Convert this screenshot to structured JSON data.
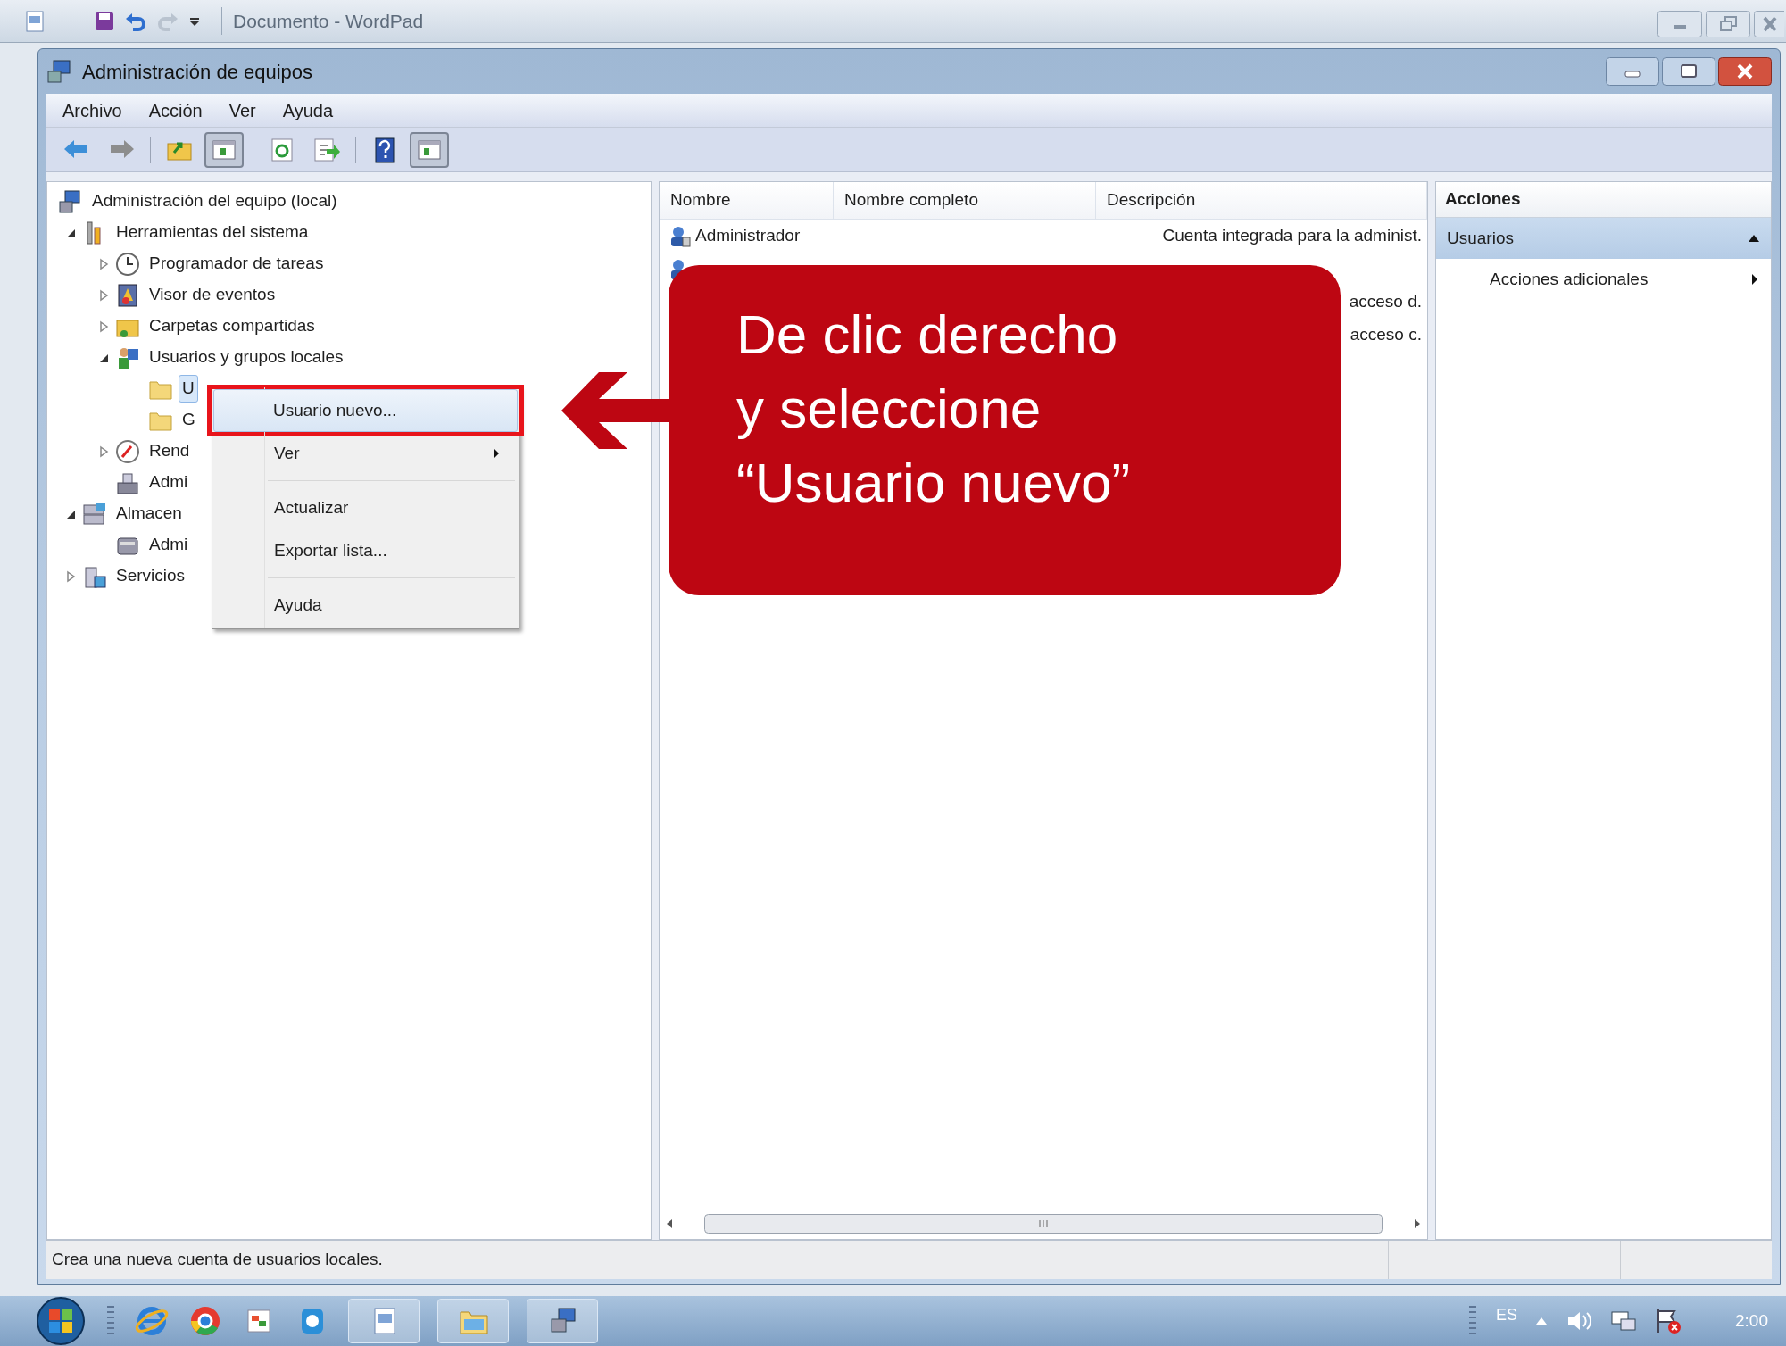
{
  "background_window": {
    "title": "Documento - WordPad"
  },
  "window": {
    "title": "Administración de equipos"
  },
  "menu": [
    "Archivo",
    "Acción",
    "Ver",
    "Ayuda"
  ],
  "toolbar": [
    {
      "pressed": false
    },
    {
      "pressed": false
    },
    {
      "pressed": false
    },
    {
      "pressed": true
    },
    {
      "pressed": false
    },
    {
      "pressed": false
    },
    {
      "pressed": false
    },
    {
      "pressed": true
    }
  ],
  "tree": [
    {
      "label": "Administración del equipo (local)",
      "selected": false,
      "children": [
        {
          "label": "Herramientas del sistema",
          "expanded": true,
          "selected": false,
          "children": [
            {
              "label": "Programador de tareas",
              "expanded": false,
              "selected": false
            },
            {
              "label": "Visor de eventos",
              "expanded": false,
              "selected": false
            },
            {
              "label": "Carpetas compartidas",
              "expanded": false,
              "selected": false
            },
            {
              "label": "Usuarios y grupos locales",
              "expanded": true,
              "selected": false,
              "children": [
                {
                  "label": "U",
                  "selected": true
                },
                {
                  "label": "G",
                  "selected": false
                }
              ]
            },
            {
              "label": "Rend",
              "expanded": false,
              "selected": false
            },
            {
              "label": "Admi",
              "selected": false
            }
          ]
        },
        {
          "label": "Almacen",
          "expanded": true,
          "selected": false,
          "children": [
            {
              "label": "Admi",
              "selected": false
            }
          ]
        },
        {
          "label": "Servicios",
          "expanded": false,
          "selected": false
        }
      ]
    }
  ],
  "list": {
    "columns": [
      "Nombre",
      "Nombre completo",
      "Descripción"
    ],
    "rows": [
      {
        "name": "Administrador",
        "description": "Cuenta integrada para la administ."
      },
      {},
      {
        "description": "acceso d."
      },
      {
        "description": "acceso c."
      }
    ]
  },
  "actions": {
    "header": "Acciones",
    "section": {
      "label": "Usuarios",
      "expanded": true
    },
    "items": [
      "Acciones adicionales"
    ]
  },
  "context_menu": {
    "items": [
      {
        "kind": "item",
        "label": "Usuario nuevo...",
        "selected": true,
        "annotated": true,
        "submenu": false
      },
      {
        "kind": "item",
        "label": "Ver",
        "selected": false,
        "annotated": false,
        "submenu": true
      },
      {
        "kind": "separator"
      },
      {
        "kind": "item",
        "label": "Actualizar",
        "selected": false,
        "annotated": false,
        "submenu": false
      },
      {
        "kind": "item",
        "label": "Exportar lista...",
        "selected": false,
        "annotated": false,
        "submenu": false
      },
      {
        "kind": "separator"
      },
      {
        "kind": "item",
        "label": "Ayuda",
        "selected": false,
        "annotated": false,
        "submenu": false
      }
    ]
  },
  "callout": {
    "lines": [
      "De clic derecho",
      "y seleccione",
      "“Usuario nuevo”"
    ]
  },
  "status_bar": "Crea una nueva cuenta de usuarios locales.",
  "tray": {
    "language": "ES",
    "clock": "2:00"
  }
}
